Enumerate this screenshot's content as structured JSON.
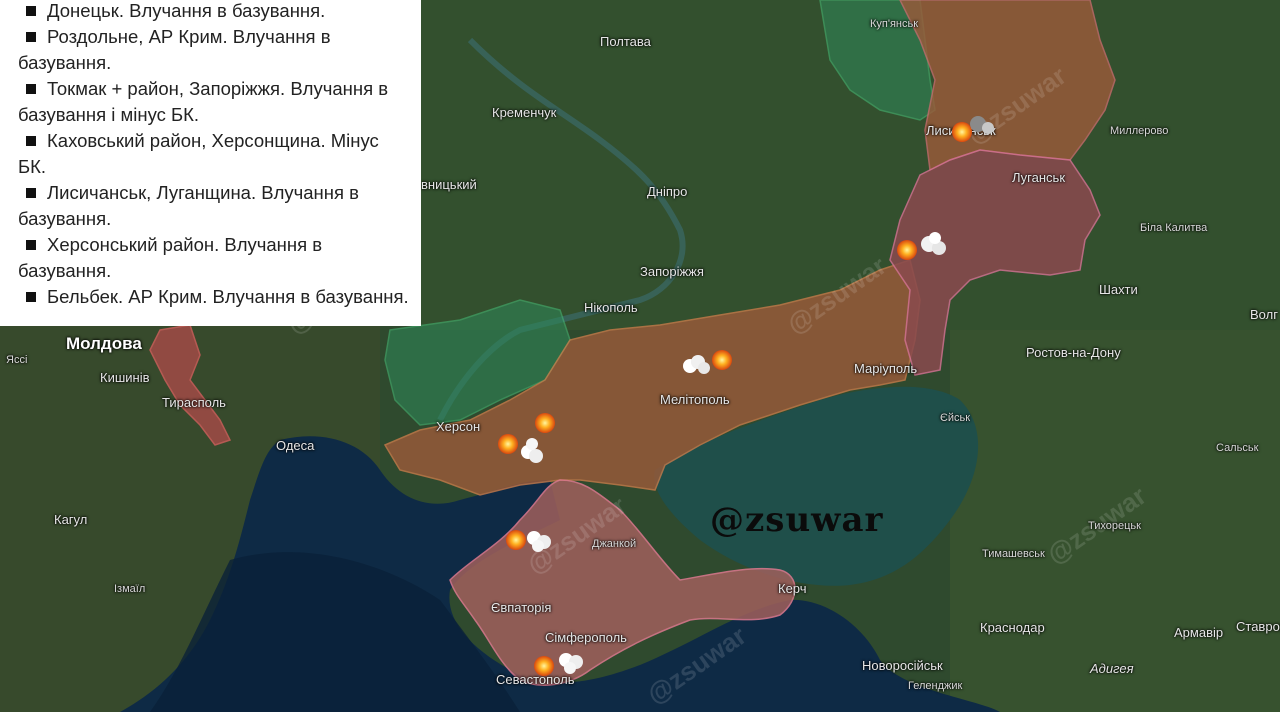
{
  "legend": {
    "items": [
      "Донецьк. Влучання в базування.",
      "Роздольне, АР Крим. Влучання в базування.",
      "Токмак + район, Запоріжжя. Влучання в базування і мінус БК.",
      "Каховський район, Херсонщина. Мінус БК.",
      "Лисичанськ, Луганщина. Влучання в базування.",
      "Херсонський район. Влучання в базування.",
      "Бельбек. АР Крим. Влучання в базування."
    ]
  },
  "watermark": "@zsuwar",
  "faint_watermark": "@zsuwar",
  "places": {
    "poltava": "Полтава",
    "kupiansk": "Куп'янськ",
    "kremenchuk": "Кременчук",
    "lysychansk": "Лисичанськ",
    "millerovo": "Миллерово",
    "dnipro": "Дніпро",
    "luhansk": "Луганськ",
    "kropyvnytskyi": "вницький",
    "bila_kalytva": "Біла Калитва",
    "zaporizhzhia": "Запоріжжя",
    "shakhty": "Шахти",
    "nikopol": "Нікополь",
    "volgo": "Волг",
    "moldova": "Молдова",
    "rostov": "Ростов-на-Дону",
    "iasi": "Яссі",
    "melitopol": "Мелітополь",
    "mariupol": "Маріуполь",
    "chisinau": "Кишинів",
    "tiraspol": "Тирасполь",
    "yeisk": "Єйськ",
    "kherson": "Херсон",
    "odesa": "Одеса",
    "salsk": "Сальськ",
    "kagul": "Кагул",
    "dzhankoi": "Джанкой",
    "tikhoretsk": "Тихорецьк",
    "timashevsk": "Тимашевськ",
    "izmail": "Ізмаїл",
    "kerch": "Керч",
    "yevpatoria": "Євпаторія",
    "krasnodar": "Краснодар",
    "armavir": "Армавір",
    "stavropol": "Ставроп",
    "simferopol": "Сімферополь",
    "novorossiysk": "Новоросійськ",
    "adygea": "Адигея",
    "sevastopol": "Севастополь",
    "gelendzhik": "Геленджик"
  },
  "colors": {
    "occupied": "#9a5a3a",
    "luhansk_region": "#8a4a4e",
    "crimea": "#a0605c",
    "transnistria": "#b04a4a",
    "liberated": "#2e8a5a",
    "sea": "#0e2a45",
    "azov": "#1f4f4a"
  },
  "strikes": [
    {
      "name": "strike-donetsk",
      "explosion": true,
      "smoke": "white"
    },
    {
      "name": "strike-lysychansk",
      "explosion": true,
      "smoke": "grey"
    },
    {
      "name": "strike-tokmak",
      "explosion": true,
      "smoke": "white"
    },
    {
      "name": "strike-kakhovka",
      "explosion": true,
      "smoke": "none"
    },
    {
      "name": "strike-kherson-district",
      "explosion": true,
      "smoke": "white"
    },
    {
      "name": "strike-rozdolne",
      "explosion": true,
      "smoke": "white"
    },
    {
      "name": "strike-belbek",
      "explosion": true,
      "smoke": "white"
    }
  ]
}
